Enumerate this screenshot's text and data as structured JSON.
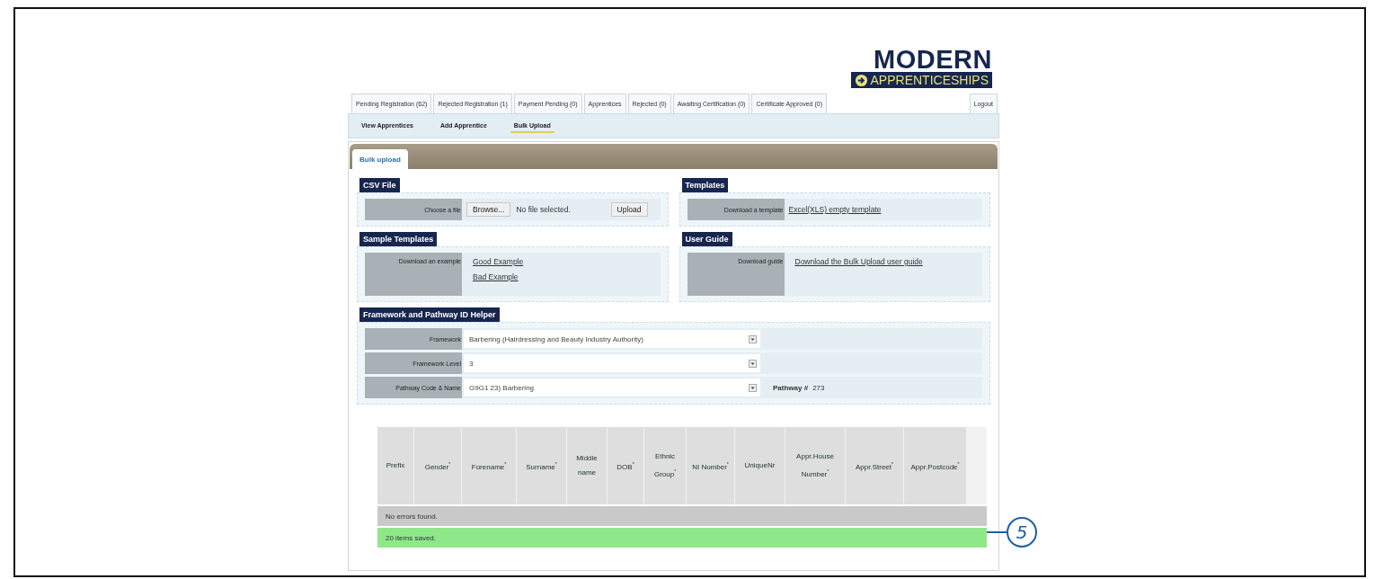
{
  "logo": {
    "line1": "MODERN",
    "line2": "APPRENTICESHIPS"
  },
  "tabs": [
    {
      "label": "Pending Registration (62)",
      "selected": false
    },
    {
      "label": "Rejected Registration (1)",
      "selected": false
    },
    {
      "label": "Payment Pending (0)",
      "selected": false
    },
    {
      "label": "Apprentices",
      "selected": false
    },
    {
      "label": "Rejected (0)",
      "selected": false
    },
    {
      "label": "Awaiting Certification (0)",
      "selected": false
    },
    {
      "label": "Certificate Approved (0)",
      "selected": false
    }
  ],
  "logout": "Logout",
  "subnav": [
    {
      "label": "View Apprentices",
      "selected": false
    },
    {
      "label": "Add Apprentice",
      "selected": false
    },
    {
      "label": "Bulk Upload",
      "selected": true
    }
  ],
  "panel_tab": "Bulk upload",
  "sections": [
    {
      "title": "CSV File",
      "label": "Choose a file",
      "kind": "file",
      "browse": "Browse...",
      "file_status": "No file selected.",
      "upload": "Upload"
    },
    {
      "title": "Templates",
      "label": "Download a template",
      "kind": "links",
      "links": [
        "Excel(XLS) empty template"
      ]
    },
    {
      "title": "Sample Templates",
      "label": "Download an example",
      "kind": "links",
      "links": [
        "Good Example",
        "Bad Example"
      ]
    },
    {
      "title": "User Guide",
      "label": "Download guide",
      "kind": "links",
      "links": [
        "Download the Bulk Upload user guide"
      ]
    }
  ],
  "helper": {
    "title": "Framework and Pathway ID Helper",
    "rows": [
      {
        "label": "Framework",
        "value": "Barbering (Hairdressing and Beauty Industry Authority)"
      },
      {
        "label": "Framework Level",
        "value": "3"
      },
      {
        "label": "Pathway Code & Name",
        "value": "G9G1 23) Barbering",
        "extra_label": "Pathway #",
        "extra_value": "273"
      }
    ]
  },
  "table": {
    "columns": [
      "Prefix",
      "Gender$^{*}$",
      "Forename$^{*}$",
      "Surname$^{*}$",
      "Middle name",
      "DOB$^{*}$",
      "Ethnic Group$^{*}$",
      "NI Number$^{*}$",
      "UniqueNr",
      "Appr.House Number$^{*}$",
      "Appr.Street$^{*}$",
      "Appr.Postcode$^{*}$"
    ],
    "messages": [
      {
        "text": "No errors found.",
        "kind": "info"
      },
      {
        "text": "20 items saved.",
        "kind": "success"
      }
    ]
  },
  "callout": "5"
}
